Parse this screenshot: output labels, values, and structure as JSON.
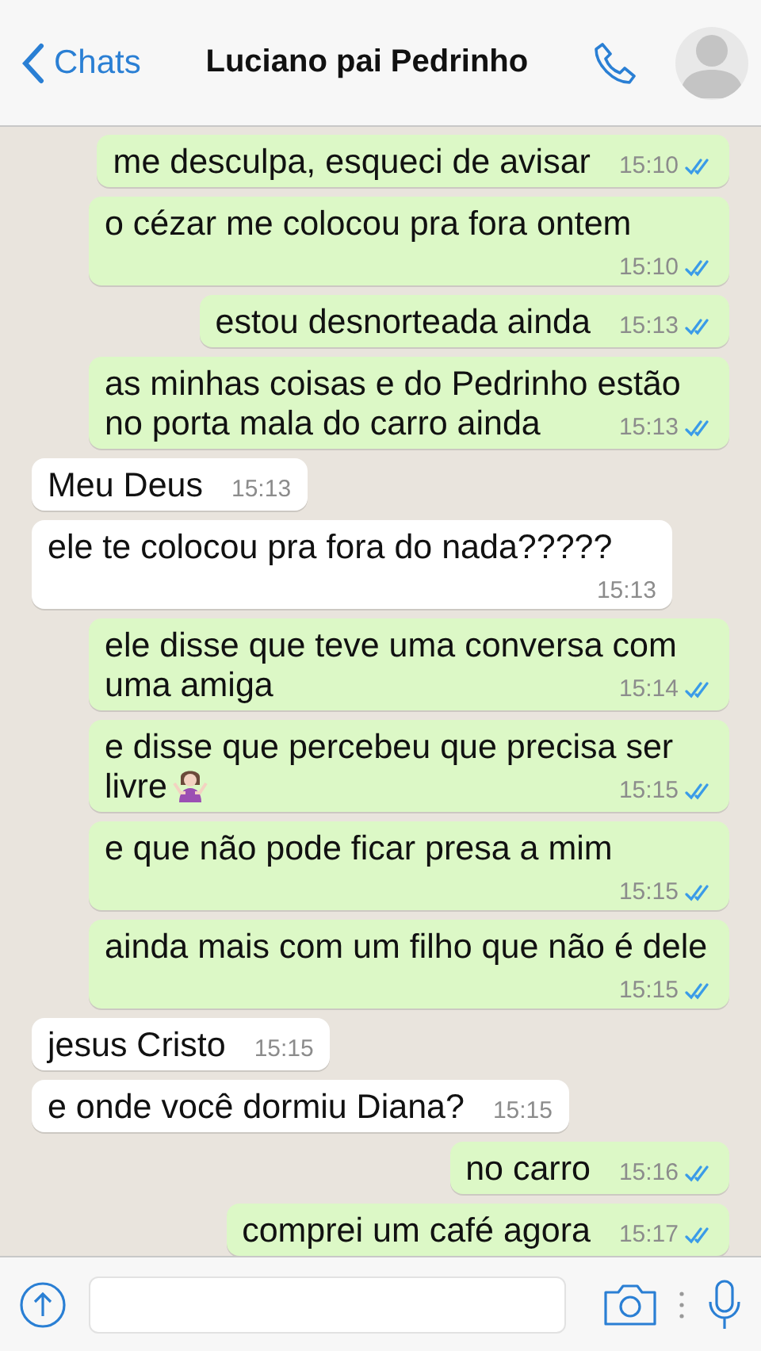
{
  "header": {
    "back_label": "Chats",
    "title": "Luciano pai Pedrinho"
  },
  "messages": [
    {
      "kind": "sent",
      "text": "me desculpa, esqueci de avisar",
      "time": "15:10",
      "read": true
    },
    {
      "kind": "sent",
      "text": "o cézar me colocou pra fora ontem",
      "time": "15:10",
      "read": true
    },
    {
      "kind": "sent",
      "text": "estou desnorteada ainda",
      "time": "15:13",
      "read": true
    },
    {
      "kind": "sent",
      "text": "as minhas coisas e do Pedrinho estão no porta mala do carro ainda",
      "time": "15:13",
      "read": true
    },
    {
      "kind": "received",
      "text": "Meu Deus",
      "time": "15:13"
    },
    {
      "kind": "received",
      "text": "ele te colocou pra fora do nada?????",
      "time": "15:13"
    },
    {
      "kind": "sent",
      "text": "ele disse que teve uma conversa com uma amiga",
      "time": "15:14",
      "read": true
    },
    {
      "kind": "sent",
      "text": "e disse que percebeu que precisa ser livre",
      "time": "15:15",
      "read": true,
      "emoji": true
    },
    {
      "kind": "sent",
      "text": "e que não pode ficar presa a mim",
      "time": "15:15",
      "read": true
    },
    {
      "kind": "sent",
      "text": "ainda mais com um filho que não é dele",
      "time": "15:15",
      "read": true
    },
    {
      "kind": "received",
      "text": "jesus Cristo",
      "time": "15:15"
    },
    {
      "kind": "received",
      "text": "e onde você dormiu Diana?",
      "time": "15:15"
    },
    {
      "kind": "sent",
      "text": "no carro",
      "time": "15:16",
      "read": true
    },
    {
      "kind": "sent",
      "text": "comprei um café agora",
      "time": "15:17",
      "read": true
    }
  ]
}
